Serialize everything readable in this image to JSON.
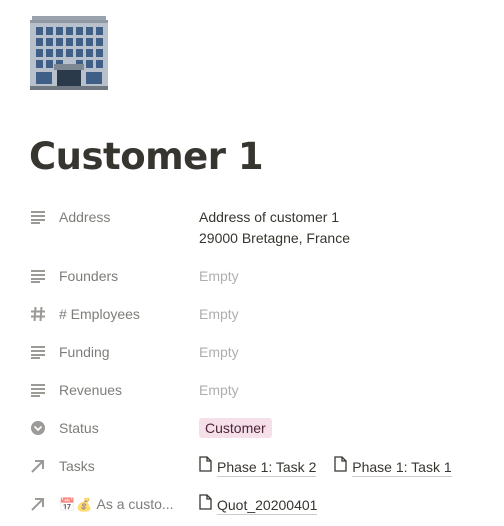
{
  "page": {
    "icon": "office-building-icon",
    "title": "Customer 1"
  },
  "properties": {
    "address": {
      "label": "Address",
      "icon": "text-lines-icon",
      "line1": "Address of customer 1",
      "line2": "29000 Bretagne, France"
    },
    "founders": {
      "label": "Founders",
      "icon": "text-lines-icon",
      "value": "Empty"
    },
    "employees": {
      "label": "# Employees",
      "icon": "hash-icon",
      "value": "Empty"
    },
    "funding": {
      "label": "Funding",
      "icon": "text-lines-icon",
      "value": "Empty"
    },
    "revenues": {
      "label": "Revenues",
      "icon": "text-lines-icon",
      "value": "Empty"
    },
    "status": {
      "label": "Status",
      "icon": "select-chevron-icon",
      "value": "Customer",
      "color": "#f5e0e9"
    },
    "tasks": {
      "label": "Tasks",
      "icon": "relation-arrow-icon",
      "items": [
        "Phase 1: Task 2",
        "Phase 1: Task 1"
      ]
    },
    "as_customer": {
      "label": "As a custo...",
      "icon": "relation-arrow-icon",
      "emoji1": "📅",
      "emoji2": "💰",
      "items": [
        "Quot_20200401"
      ]
    }
  }
}
